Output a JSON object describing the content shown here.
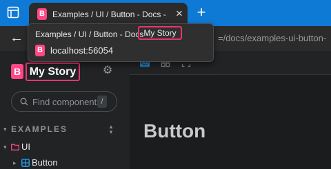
{
  "browser": {
    "tab_title": "Examples / UI / Button - Docs - My Story",
    "new_tab_symbol": "+",
    "close_symbol": "×",
    "url_fragment": "=/docs/examples-ui-button-"
  },
  "hover_card": {
    "title_prefix": "Examples / UI / Button - Docs -",
    "title_highlight": "My Story",
    "host": "localhost:56054",
    "logo_letter": "B"
  },
  "sidebar": {
    "logo_letter": "B",
    "brand_title": "My Story",
    "search_placeholder": "Find components",
    "search_shortcut": "/",
    "section_title": "EXAMPLES",
    "tree": [
      {
        "label": "UI",
        "icon": "folder-icon"
      },
      {
        "label": "Button",
        "icon": "component-icon"
      }
    ]
  },
  "main": {
    "heading": "Button"
  },
  "colors": {
    "tab_bar": "#0f7ad6",
    "brand_pink": "#ff4785",
    "highlight_border": "#e8366f",
    "folder": "#ff4785",
    "component": "#1ea7fd"
  }
}
